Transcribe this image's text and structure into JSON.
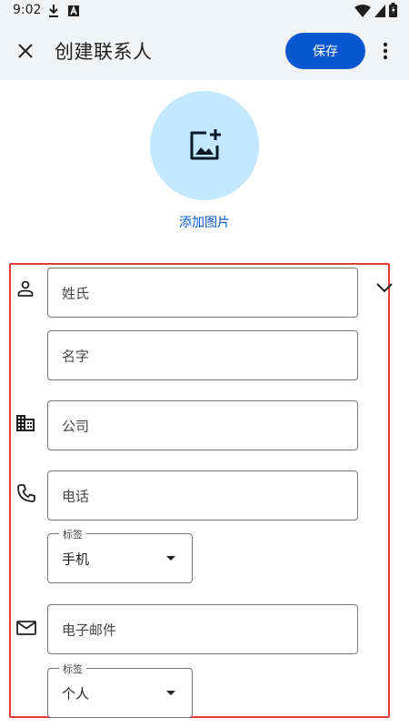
{
  "status_bar": {
    "time": "9:02",
    "icons": [
      "download-icon",
      "a-box-icon",
      "wifi-icon",
      "battery-icon"
    ]
  },
  "app_bar": {
    "title": "创建联系人",
    "save_label": "保存",
    "close_icon": "close-icon",
    "more_icon": "more-vert-icon"
  },
  "photo": {
    "icon": "add-photo-icon",
    "link_label": "添加图片"
  },
  "form": {
    "last_name_placeholder": "姓氏",
    "first_name_placeholder": "名字",
    "company_placeholder": "公司",
    "phone_placeholder": "电话",
    "phone_label_caption": "标签",
    "phone_label_value": "手机",
    "email_placeholder": "电子邮件",
    "email_label_caption": "标签",
    "email_label_value": "个人"
  },
  "colors": {
    "accent": "#0b57d0",
    "photo_bg": "#c2e7ff",
    "highlight": "#e53935",
    "bar_bg": "#f1f3f4"
  }
}
